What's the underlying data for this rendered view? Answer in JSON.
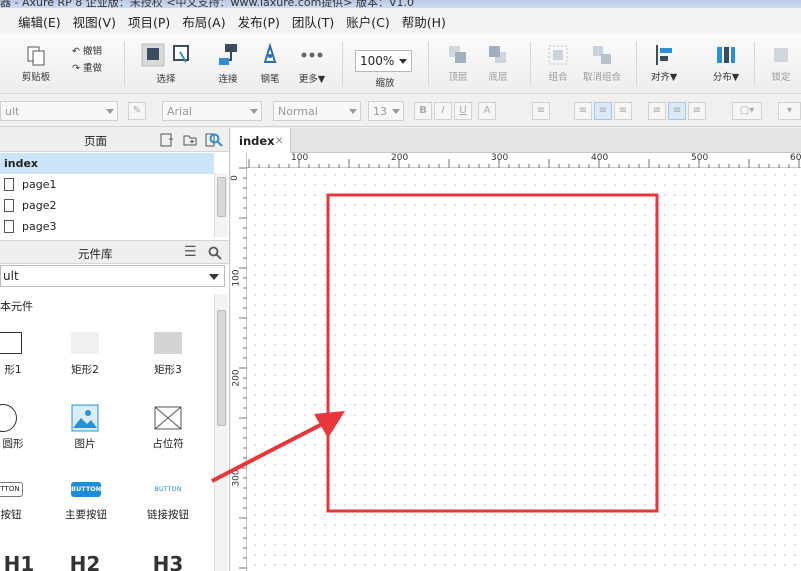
{
  "title": "器 - Axure RP 8 企业版：未授权 <中文支持：www.iaxure.com提供> 版本：V1.0",
  "menu": [
    "编辑(E)",
    "视图(V)",
    "项目(P)",
    "布局(A)",
    "发布(P)",
    "团队(T)",
    "账户(C)",
    "帮助(H)"
  ],
  "ribbon": {
    "clipboard": "剪贴板",
    "undo": "撤销",
    "redo": "重做",
    "select": "选择",
    "connect": "连接",
    "pen": "钢笔",
    "more": "更多▼",
    "zoom_value": "100%",
    "zoom": "缩放",
    "top": "顶层",
    "bottom": "底层",
    "group": "组合",
    "ungroup": "取消组合",
    "align": "对齐▼",
    "distribute": "分布▼",
    "lock": "锁定"
  },
  "format": {
    "style": "ult",
    "font": "Arial",
    "weight": "Normal",
    "size": "13"
  },
  "pages_panel": {
    "title": "页面",
    "items": [
      {
        "label": "index"
      },
      {
        "label": "page1"
      },
      {
        "label": "page2"
      },
      {
        "label": "page3"
      }
    ]
  },
  "library_panel": {
    "title": "元件库",
    "selected": "ult",
    "category": "本元件",
    "widgets": [
      {
        "label": "形1"
      },
      {
        "label": "矩形2"
      },
      {
        "label": "矩形3"
      },
      {
        "label": "圆形"
      },
      {
        "label": "图片"
      },
      {
        "label": "占位符"
      },
      {
        "label": "按钮"
      },
      {
        "label": "主要按钮"
      },
      {
        "label": "链接按钮"
      },
      {
        "label": "H1"
      },
      {
        "label": "H2"
      },
      {
        "label": "H3"
      }
    ],
    "button_text": "BUTTON",
    "button_text_short": "TTON"
  },
  "canvas": {
    "tab": "index",
    "tab_close": "×",
    "ruler_h": [
      "100",
      "200",
      "300",
      "400",
      "500",
      "60"
    ],
    "ruler_v": [
      "0",
      "100",
      "200",
      "300"
    ]
  },
  "colors": {
    "annotation": "#e8363a",
    "accent": "#2a8fd4",
    "selection": "#cce4f7"
  }
}
